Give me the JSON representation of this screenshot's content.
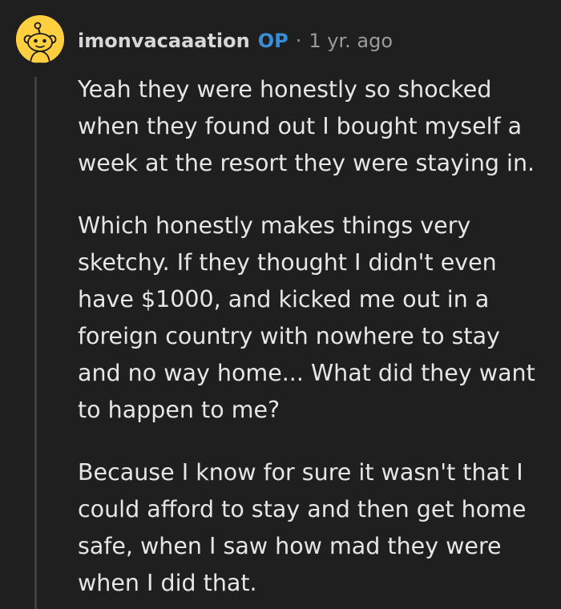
{
  "comment": {
    "username": "imonvacaaation",
    "op_badge": "OP",
    "separator": "·",
    "age": "1 yr. ago",
    "paragraphs": [
      "Yeah they were honestly so shocked\nwhen they found out I bought myself a\nweek at the resort they were staying in.",
      "Which honestly makes things very\nsketchy. If they thought I didn't even\nhave $1000, and kicked me out in a\nforeign country with nowhere to stay\nand no way home... What did they want\nto happen to me?",
      "Because I know for sure it wasn't that I\ncould afford to stay and then get home\nsafe, when I saw how mad they were\nwhen I did that."
    ]
  },
  "icons": {
    "avatar": "snoo-avatar-icon"
  },
  "colors": {
    "background": "#1f1f1f",
    "text": "#e6e6e6",
    "op_badge": "#3a8ed8",
    "avatar_background": "#ffcf3f",
    "thread_line": "#3e3e3e"
  }
}
